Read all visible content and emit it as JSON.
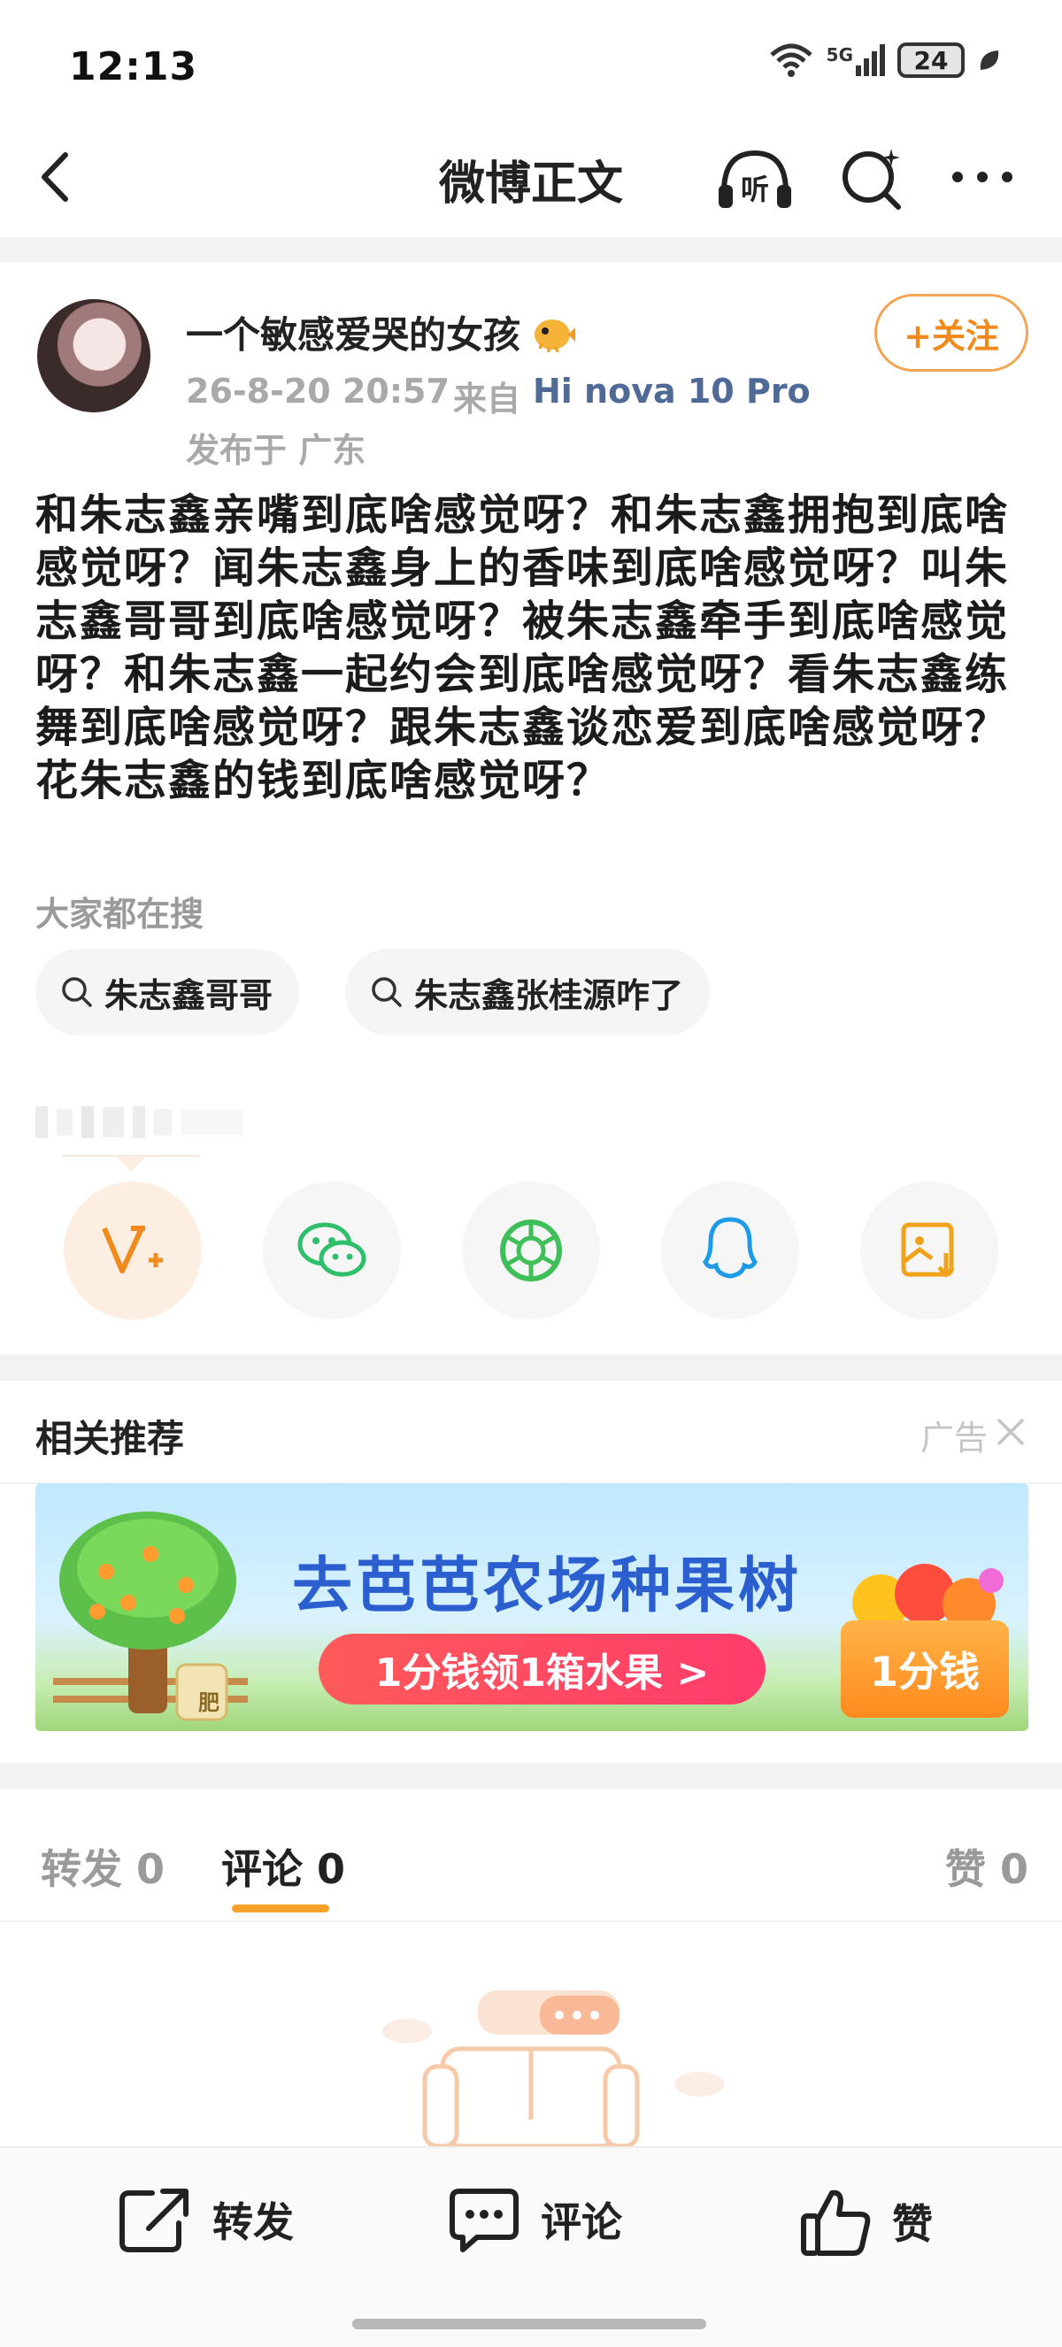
{
  "status_bar": {
    "time": "12:13",
    "network": "5G",
    "battery": "24"
  },
  "nav": {
    "title": "微博正文"
  },
  "post": {
    "username": "一个敏感爱哭的女孩",
    "time": "26-8-20 20:57",
    "from_label": "来自",
    "device": "Hi nova 10 Pro",
    "location": "发布于 广东",
    "follow_label": "+关注",
    "body": "和朱志鑫亲嘴到底啥感觉呀？和朱志鑫拥抱到底啥感觉呀？闻朱志鑫身上的香味到底啥感觉呀？叫朱志鑫哥哥到底啥感觉呀？被朱志鑫牵手到底啥感觉呀？和朱志鑫一起约会到底啥感觉呀？看朱志鑫练舞到底啥感觉呀？跟朱志鑫谈恋爱到底啥感觉呀？花朱志鑫的钱到底啥感觉呀？"
  },
  "searching": {
    "label": "大家都在搜",
    "chips": [
      "朱志鑫哥哥",
      "朱志鑫张桂源咋了"
    ]
  },
  "related": {
    "title": "相关推荐",
    "ad_label": "广告",
    "banner": {
      "headline": "去芭芭农场种果树",
      "cta": "1分钱领1箱水果 >",
      "badge": "1分钱",
      "sack_label": "肥"
    }
  },
  "tabs": {
    "reposts": "转发 0",
    "comments": "评论 0",
    "likes": "赞 0"
  },
  "bottom_bar": {
    "repost": "转发",
    "comment": "评论",
    "like": "赞"
  },
  "colors": {
    "accent_orange": "#f08a1c",
    "device_blue": "#4f6a96",
    "tab_underline": "#f7a12b"
  }
}
